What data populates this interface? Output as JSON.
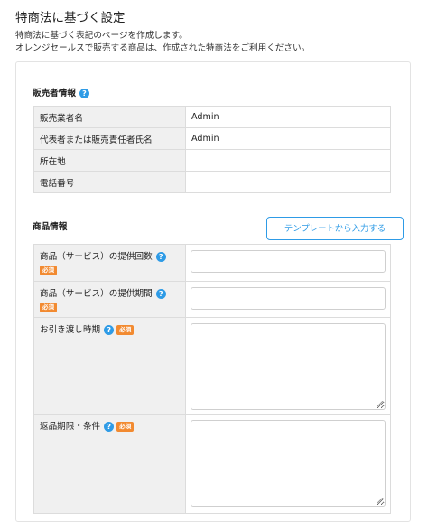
{
  "page": {
    "title": "特商法に基づく設定",
    "desc_line1": "特商法に基づく表記のページを作成します。",
    "desc_line2": "オレンジセールスで販売する商品は、作成された特商法をご利用ください。"
  },
  "seller": {
    "title": "販売者情報",
    "rows": [
      {
        "label": "販売業者名",
        "value": "Admin"
      },
      {
        "label": "代表者または販売責任者氏名",
        "value": "Admin"
      },
      {
        "label": "所在地",
        "value": ""
      },
      {
        "label": "電話番号",
        "value": ""
      }
    ]
  },
  "product": {
    "title": "商品情報",
    "template_button": "テンプレートから入力する",
    "required_badge": "必須",
    "rows": [
      {
        "label": "商品（サービス）の提供回数",
        "value": ""
      },
      {
        "label": "商品（サービス）の提供期間",
        "value": ""
      },
      {
        "label": "お引き渡し時期",
        "value": ""
      },
      {
        "label": "返品期限・条件",
        "value": ""
      }
    ]
  },
  "icons": {
    "help": "question-circle-icon",
    "resize": "resize-grip-icon"
  },
  "colors": {
    "accent": "#2e9be6",
    "badge": "#f28a30",
    "label_bg": "#f0f0f0"
  }
}
